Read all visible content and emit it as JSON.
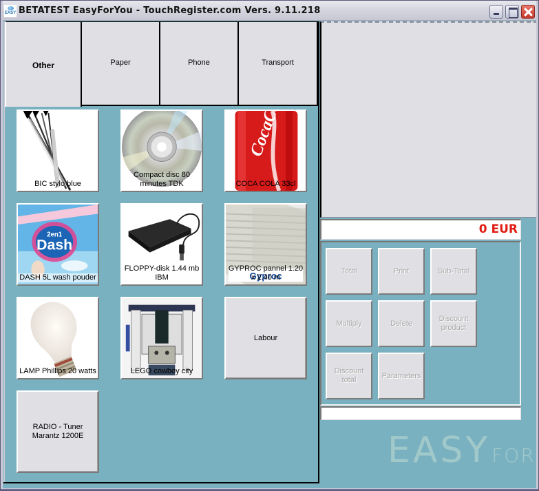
{
  "window": {
    "title": "BETATEST EasyForYou - TouchRegister.com Vers. 9.11.218",
    "app_icon_text": "EASY",
    "controls": [
      "minimize",
      "maximize",
      "close"
    ]
  },
  "tabs": [
    {
      "label": "Other",
      "active": true
    },
    {
      "label": "Paper",
      "active": false
    },
    {
      "label": "Phone",
      "active": false
    },
    {
      "label": "Transport",
      "active": false
    }
  ],
  "products": [
    {
      "label": "BIC stylo blue",
      "image": "pens"
    },
    {
      "label": "Compact disc 80 minutes TDK",
      "image": "cd"
    },
    {
      "label": "COCA COLA 33cl",
      "image": "coca-cola-can"
    },
    {
      "label": "DASH 5L wash pouder",
      "image": "dash-box"
    },
    {
      "label": "FLOPPY-disk 1.44 mb IBM",
      "image": "floppy-drive"
    },
    {
      "label": "GYPROC pannel 1.20 x 2.40 m",
      "image": "plasterboard"
    },
    {
      "label": "LAMP Phillips 20 watts",
      "image": "light-bulb"
    },
    {
      "label": "LEGO cowboy city",
      "image": "lego"
    },
    {
      "label": "Labour",
      "image": null
    },
    {
      "label": "RADIO - Tuner Marantz 1200E",
      "image": null
    }
  ],
  "total": {
    "amount": "0",
    "currency": "EUR",
    "display": "0 EUR",
    "color": "#e01e14"
  },
  "functions": [
    {
      "label": "Total",
      "enabled": false
    },
    {
      "label": "Print",
      "enabled": false
    },
    {
      "label": "Sub-Total",
      "enabled": false
    },
    {
      "label": "Multiply",
      "enabled": false
    },
    {
      "label": "Delete",
      "enabled": false
    },
    {
      "label": "Discount product",
      "enabled": false
    },
    {
      "label": "Discount total",
      "enabled": false
    },
    {
      "label": "Parameters",
      "enabled": false
    }
  ],
  "status_text": "",
  "logo": {
    "main": "EASY",
    "suffix": "FOR"
  },
  "colors": {
    "background": "#7ab1c1",
    "panel": "#e0e0e4",
    "total_text": "#e01e14"
  }
}
